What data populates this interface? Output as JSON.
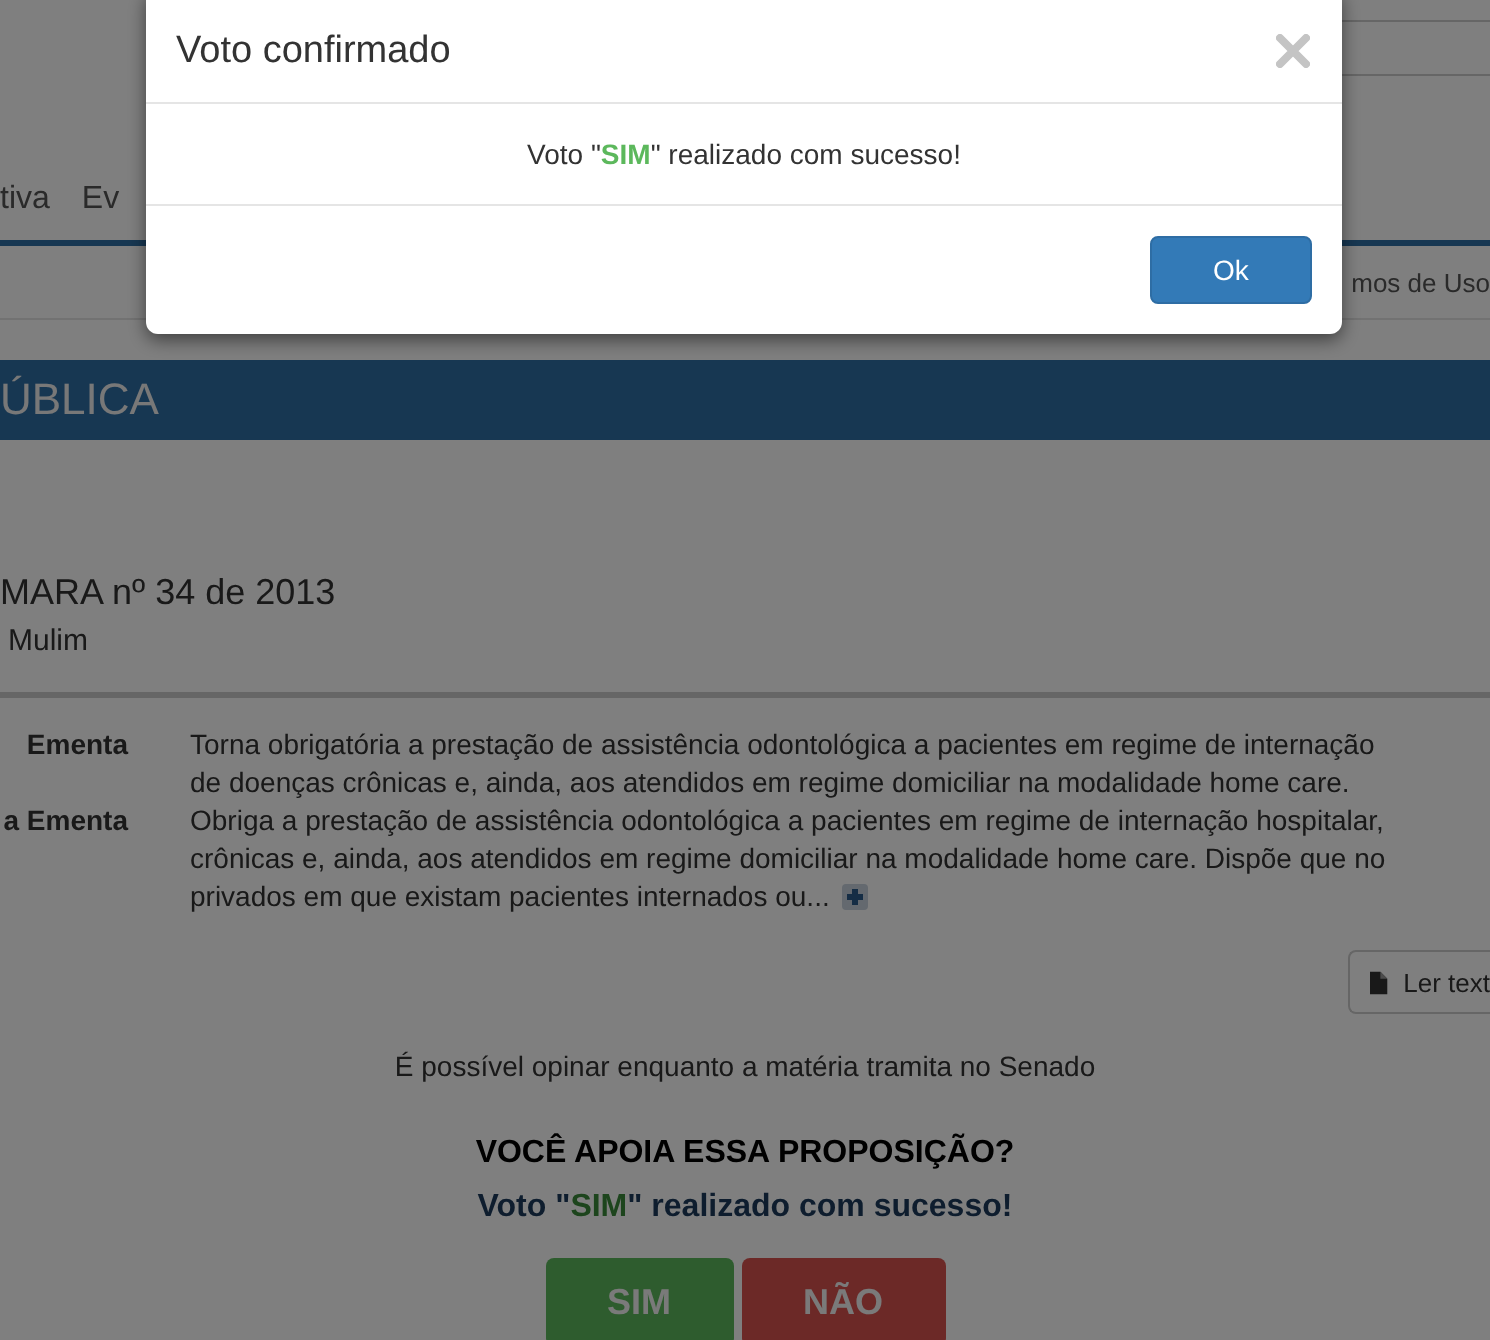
{
  "nav": [
    {
      "label": "tiva"
    },
    {
      "label": "Ev"
    }
  ],
  "top_link": "mos de Uso",
  "banner": {
    "title": "ÚBLICA"
  },
  "proposal": {
    "title": "MARA nº 34 de 2013",
    "author": "Mulim"
  },
  "details": [
    {
      "label": "Ementa",
      "lines": [
        "Torna obrigatória a prestação de assistência odontológica a pacientes em regime de internação",
        "de doenças crônicas e, ainda, aos atendidos em regime domiciliar na modalidade home care."
      ]
    },
    {
      "label": "a Ementa",
      "lines": [
        "Obriga a prestação de assistência odontológica a pacientes em regime de internação hospitalar,",
        "crônicas e, ainda, aos atendidos em regime domiciliar na modalidade home care. Dispõe que no",
        "privados em que existam pacientes internados ou..."
      ]
    }
  ],
  "read_button": "Ler text",
  "notice": "É possível opinar enquanto a matéria tramita no Senado",
  "vote": {
    "question": "VOCÊ APOIA ESSA PROPOSIÇÃO?",
    "result": {
      "prefix": "Voto \"",
      "choice": "SIM",
      "suffix": "\" realizado com sucesso!"
    }
  },
  "buttons": [
    {
      "label": "SIM",
      "kind": "yes"
    },
    {
      "label": "NÃO",
      "kind": "no"
    }
  ],
  "modal": {
    "title": "Voto confirmado",
    "message": {
      "prefix": "Voto \"",
      "choice": "SIM",
      "suffix": "\" realizado com sucesso!"
    },
    "ok": "Ok"
  }
}
